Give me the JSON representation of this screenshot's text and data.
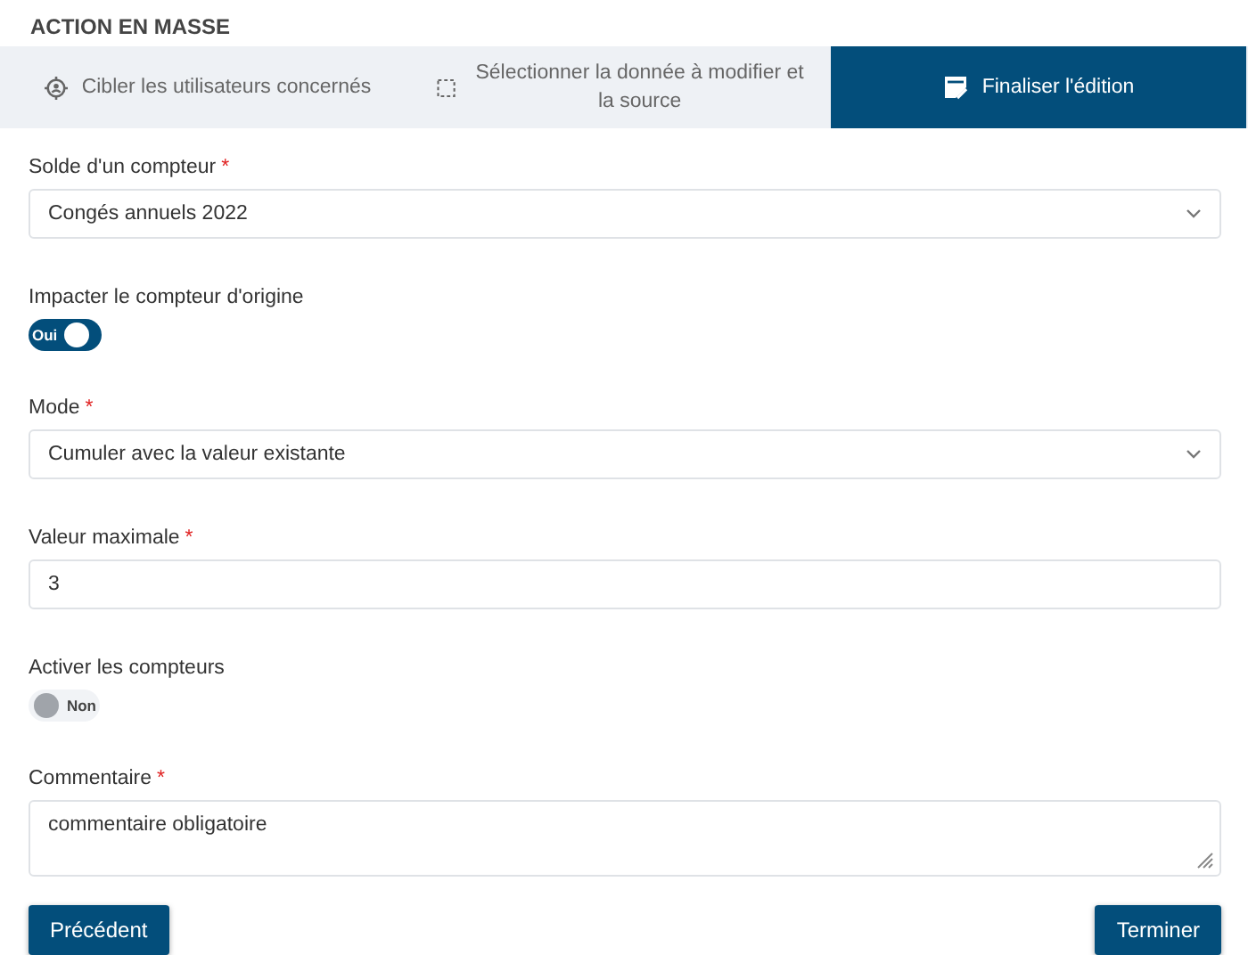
{
  "title": "ACTION EN MASSE",
  "tabs": [
    {
      "label": "Cibler les utilisateurs concernés",
      "selected": false
    },
    {
      "label": "Sélectionner la donnée à modifier et la source",
      "selected": false
    },
    {
      "label": "Finaliser l'édition",
      "selected": true
    }
  ],
  "fields": [
    {
      "kind": "select",
      "label": "Solde d'un compteur",
      "required_mark": "*",
      "value": "Congés annuels 2022"
    },
    {
      "kind": "toggle",
      "label": "Impacter le compteur d'origine",
      "on": true,
      "value": "Oui"
    },
    {
      "kind": "select",
      "label": "Mode",
      "required_mark": "*",
      "value": "Cumuler avec la valeur existante"
    },
    {
      "kind": "text",
      "label": "Valeur maximale",
      "required_mark": "*",
      "value": "3"
    },
    {
      "kind": "toggle",
      "label": "Activer les compteurs",
      "on": false,
      "value": "Non"
    },
    {
      "kind": "textarea",
      "label": "Commentaire",
      "required_mark": "*",
      "value": "commentaire obligatoire"
    }
  ],
  "buttons": {
    "back": "Précédent",
    "finish": "Terminer"
  }
}
